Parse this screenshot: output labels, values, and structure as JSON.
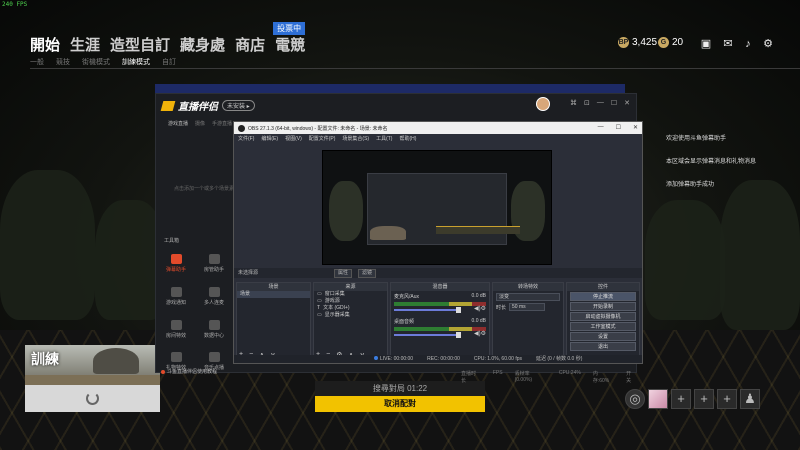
{
  "fps": "240 FPS",
  "nav": {
    "items": [
      "開始",
      "生涯",
      "造型自訂",
      "藏身處",
      "商店",
      "電競"
    ],
    "badge": "投票中",
    "sub": [
      "一般",
      "競技",
      "街機模式",
      "訓練模式",
      "自訂"
    ]
  },
  "currency": {
    "bp_icon": "BP",
    "bp": "3,425",
    "g_icon": "G",
    "g": "20"
  },
  "top_icons": [
    "inbox-icon",
    "mail-icon",
    "bell-icon",
    "gear-icon"
  ],
  "messages": [
    "欢迎使用斗鱼弹幕助手",
    "本区域会显示弹幕消息和礼物消息",
    "添加弹幕助手成功"
  ],
  "training": {
    "title": "訓練"
  },
  "match": {
    "status": "搜尋對局 01:22",
    "cancel": "取消配對"
  },
  "team": {
    "add": "+",
    "group_icon": "group-icon"
  },
  "helper": {
    "name": "直播伴侣",
    "pill": "未安装 ▸",
    "controls": [
      "⌘",
      "⊡",
      "—",
      "☐",
      "✕"
    ],
    "tabs": [
      "游戏直播",
      "摄像",
      "手游直播"
    ],
    "hint": "点击添加一个或多个场景素材",
    "toolbox": "工具箱",
    "tools": [
      "弹幕助手",
      "房管助手",
      "游戏通知",
      "多人连麦",
      "房间特效",
      "数据中心",
      "礼物特效",
      "音乐点播"
    ],
    "radio": "斗鱼直播伴侣使用教程",
    "bottom": [
      "直播时长",
      "FPS",
      "丢帧率(0.00%)",
      "CPU:24%",
      "内存:60%",
      "开关"
    ]
  },
  "obs": {
    "title": "OBS 27.1.3 (64-bit, windows) - 配置文件: 未命名 - 场景: 未命名",
    "winctl": [
      "—",
      "☐",
      "✕"
    ],
    "menu": [
      "文件(F)",
      "编辑(E)",
      "视图(V)",
      "配置文件(P)",
      "场景集合(S)",
      "工具(T)",
      "帮助(H)"
    ],
    "no_source": "未选择源",
    "props": "属性",
    "filters": "滤镜",
    "docks": {
      "scenes": {
        "header": "场景",
        "items": [
          "场景"
        ]
      },
      "sources": {
        "header": "来源",
        "items": [
          "窗口采集",
          "游戏源",
          "文本 (GDI+)",
          "显示器采集"
        ]
      },
      "mixer": {
        "header": "混音器",
        "channels": [
          {
            "name": "麦克风/Aux",
            "db": "0.0 dB"
          },
          {
            "name": "桌面音频",
            "db": "0.0 dB"
          }
        ]
      },
      "transitions": {
        "header": "转场特效",
        "type": "淡变",
        "duration_label": "时长",
        "duration": "50 ms"
      },
      "controls": {
        "header": "控件",
        "buttons": [
          "停止推流",
          "开始录制",
          "启动虚拟摄像机",
          "工作室模式",
          "设置",
          "退出"
        ]
      }
    },
    "status": [
      "LIVE: 00:00:00",
      "REC: 00:00:00",
      "CPU: 1.0%, 60.00 fps",
      "延迟 (0 / 帧数 0.0 秒)"
    ]
  }
}
